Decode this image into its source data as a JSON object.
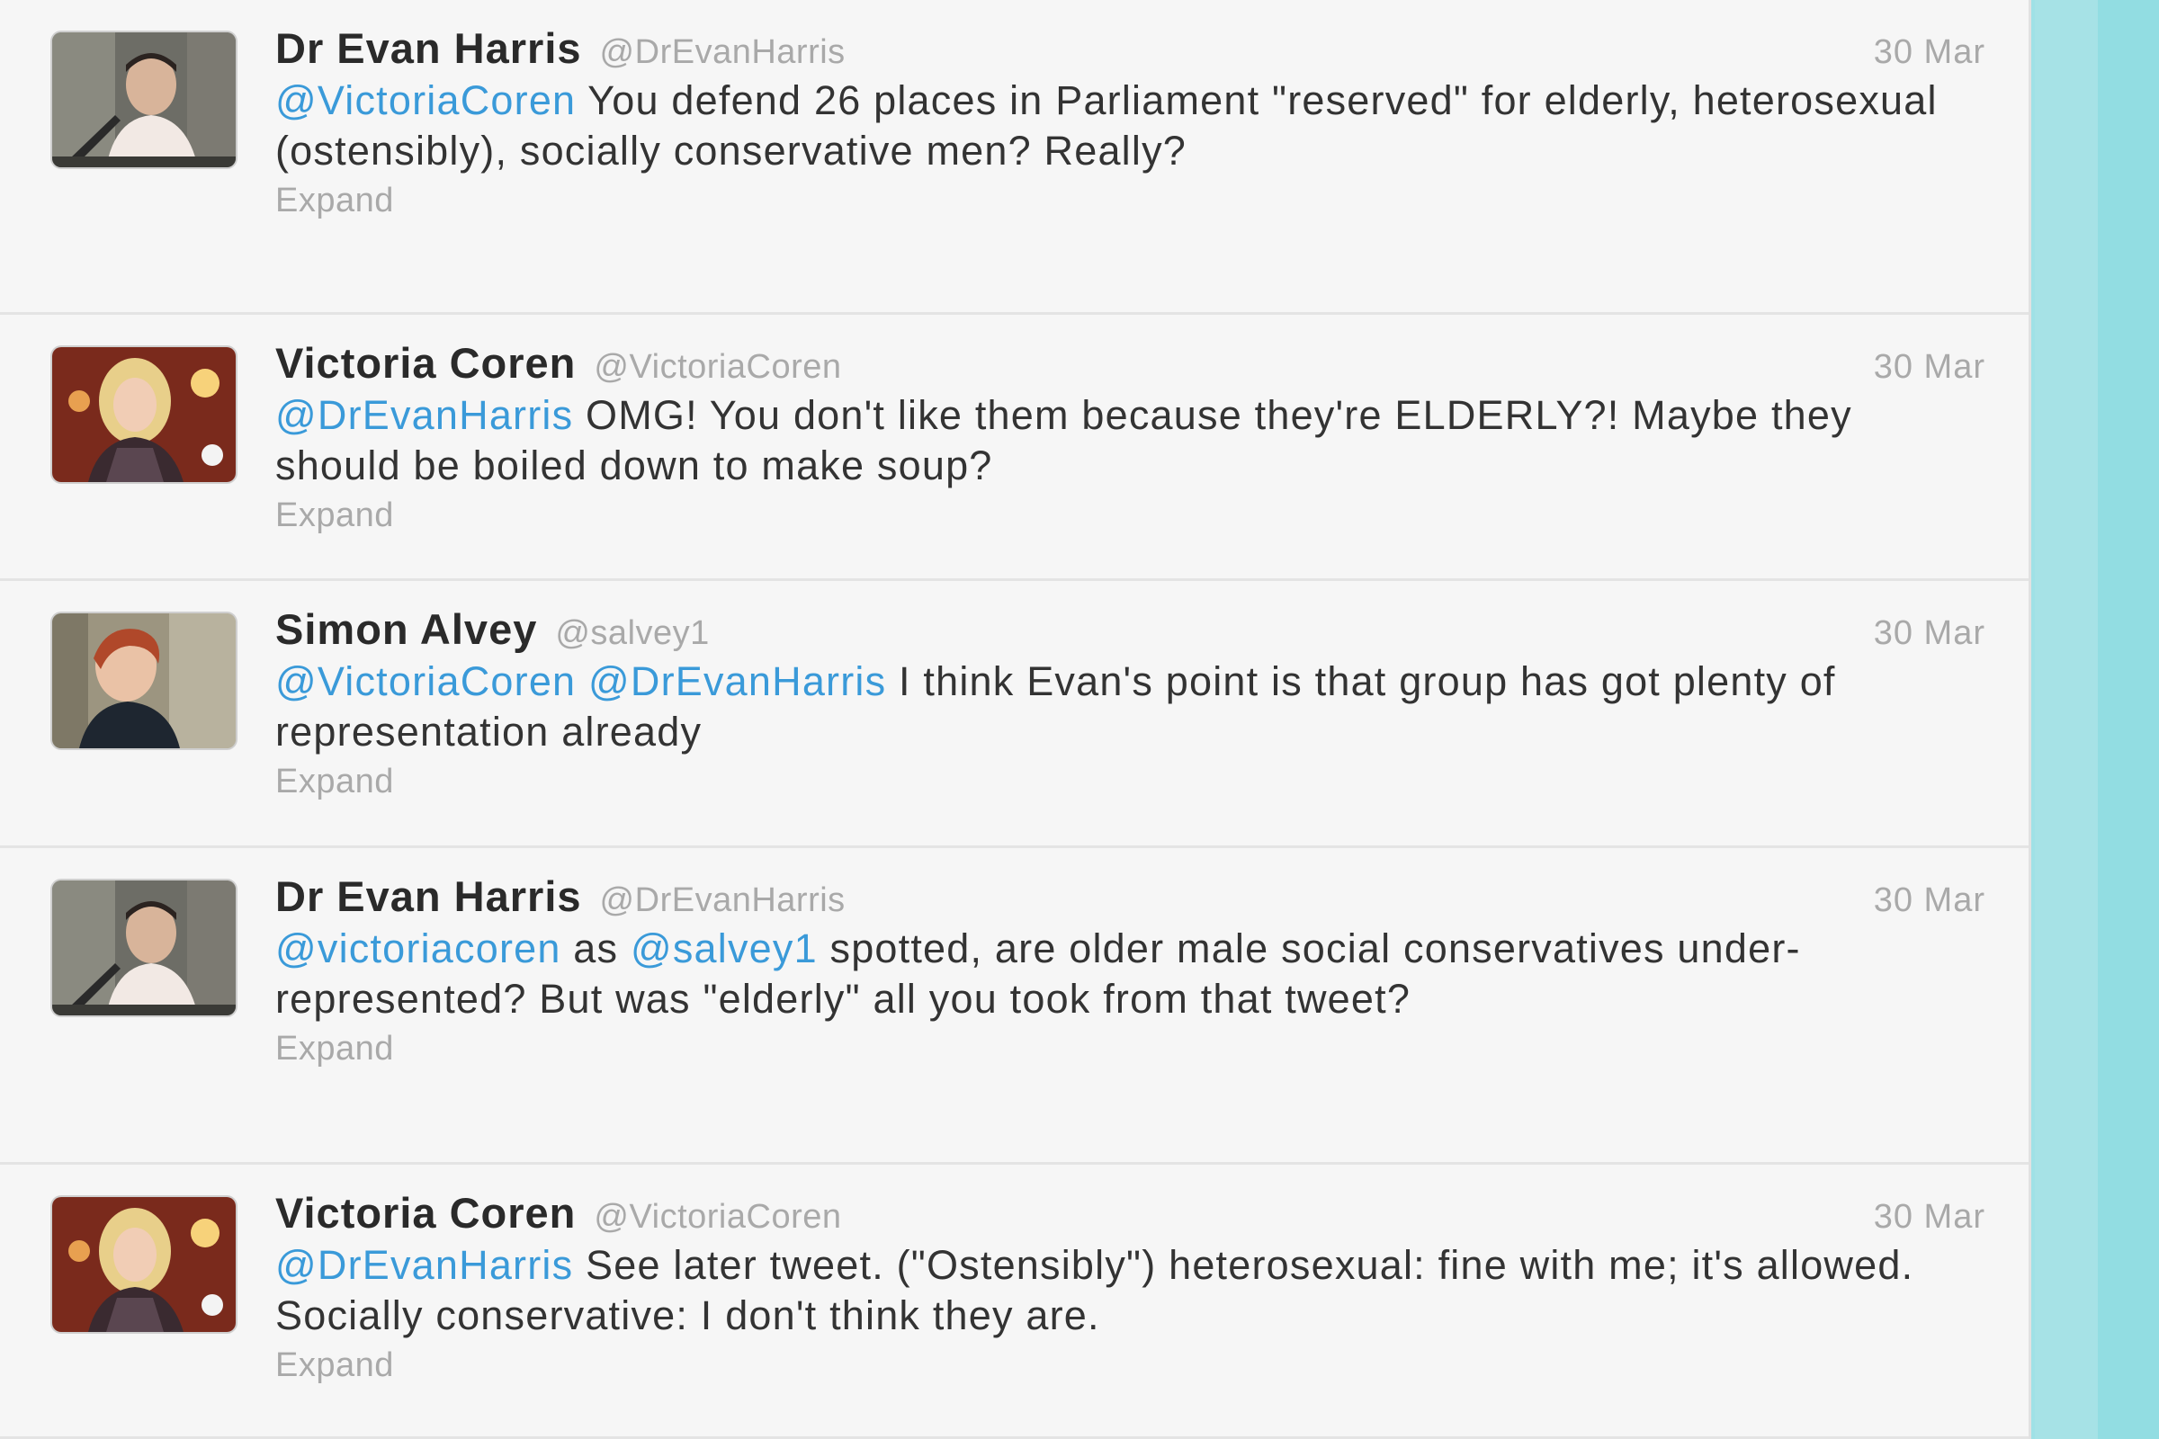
{
  "colors": {
    "page_background": "#9fe1e6",
    "timeline_background": "#f6f6f6",
    "mention": "#3a9ad9",
    "fullname": "#2a2a2a",
    "meta_text": "#a9a9a9",
    "body_text": "#333333"
  },
  "tweets": [
    {
      "avatar_icon": "avatar-evan-harris",
      "fullname": "Dr Evan Harris",
      "username": "@DrEvanHarris",
      "timestamp": "30 Mar",
      "mention_1": "@VictoriaCoren",
      "text_1": " You defend 26 places in Parliament \"reserved\" for elderly, heterosexual (ostensibly), socially conservative men? Really?",
      "expand_label": "Expand"
    },
    {
      "avatar_icon": "avatar-victoria-coren",
      "fullname": "Victoria Coren",
      "username": "@VictoriaCoren",
      "timestamp": "30 Mar",
      "mention_1": "@DrEvanHarris",
      "text_1": " OMG! You don't like them because they're ELDERLY?! Maybe they should be boiled down to make soup?",
      "expand_label": "Expand"
    },
    {
      "avatar_icon": "avatar-simon-alvey",
      "fullname": "Simon Alvey",
      "username": "@salvey1",
      "timestamp": "30 Mar",
      "mention_1": "@VictoriaCoren",
      "text_1": " ",
      "mention_2": "@DrEvanHarris",
      "text_2": " I think Evan's point is that group has got plenty of representation already",
      "expand_label": "Expand"
    },
    {
      "avatar_icon": "avatar-evan-harris",
      "fullname": "Dr Evan Harris",
      "username": "@DrEvanHarris",
      "timestamp": "30 Mar",
      "mention_1": "@victoriacoren",
      "text_1": " as ",
      "mention_2": "@salvey1",
      "text_2": " spotted, are older male social conservatives under-represented? But was \"elderly\" all you took from that tweet?",
      "expand_label": "Expand"
    },
    {
      "avatar_icon": "avatar-victoria-coren",
      "fullname": "Victoria Coren",
      "username": "@VictoriaCoren",
      "timestamp": "30 Mar",
      "mention_1": "@DrEvanHarris",
      "text_1": " See later tweet. (\"Ostensibly\") heterosexual: fine with me; it's allowed. Socially conservative: I don't think they are.",
      "expand_label": "Expand"
    }
  ]
}
